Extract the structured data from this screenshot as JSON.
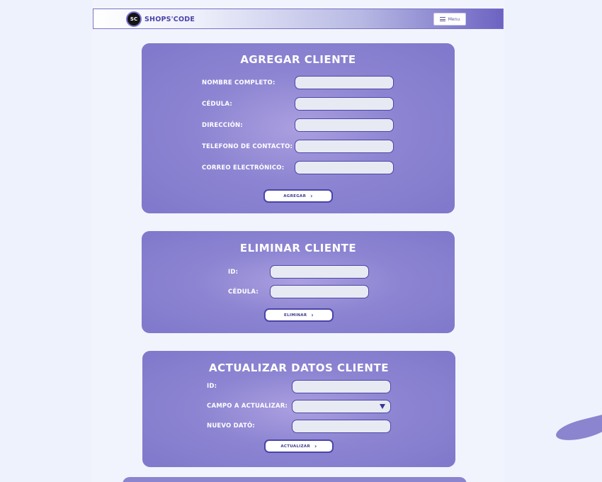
{
  "navbar": {
    "logo_text": "SC",
    "brand": "SHOPS'CODE",
    "menu_label": "Menu"
  },
  "add_client": {
    "title": "AGREGAR CLIENTE",
    "fields": [
      {
        "label": "NOMBRE COMPLETO:",
        "value": ""
      },
      {
        "label": "CÉDULA:",
        "value": ""
      },
      {
        "label": "DIRECCIÓN:",
        "value": ""
      },
      {
        "label": "TELEFONO DE CONTACTO:",
        "value": ""
      },
      {
        "label": "CORREO ELECTRÓNICO:",
        "value": ""
      }
    ],
    "button": "AGREGAR"
  },
  "delete_client": {
    "title": "ELIMINAR CLIENTE",
    "fields": [
      {
        "label": "ID:",
        "value": ""
      },
      {
        "label": "CÉDULA:",
        "value": ""
      }
    ],
    "button": "ELIMINAR"
  },
  "update_client": {
    "title": "ACTUALIZAR DATOS CLIENTE",
    "fields": [
      {
        "label": "ID:",
        "value": ""
      },
      {
        "label": "CAMPO A ACTUALIZAR:",
        "value": ""
      },
      {
        "label": "NUEVO DATÓ:",
        "value": ""
      }
    ],
    "button": "ACTUALIZAR"
  },
  "icons": {
    "menu": "hamburger-icon",
    "button_chevron": "chevron-right-icon",
    "select_arrow": "caret-down-icon"
  },
  "colors": {
    "card": "#8d85d2",
    "accent": "#4a44a8",
    "input_bg": "#e7eaf3",
    "page_bg": "#eef2fd"
  }
}
